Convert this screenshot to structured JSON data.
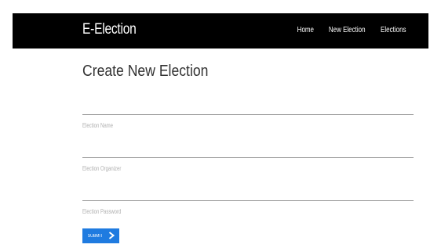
{
  "navbar": {
    "brand": "E-Election",
    "links": [
      "Home",
      "New Election",
      "Elections"
    ]
  },
  "page": {
    "title": "Create New Election"
  },
  "form": {
    "fields": [
      {
        "label": "Election Name"
      },
      {
        "label": "Election Organizer"
      },
      {
        "label": "Election Password"
      }
    ],
    "submit_label": "SUBMIT"
  },
  "colors": {
    "navbar_bg": "#000000",
    "button_bg": "#1f7be0",
    "field_rule": "#9a9a9a"
  },
  "icons": {
    "submit": "chevron-right-icon"
  }
}
